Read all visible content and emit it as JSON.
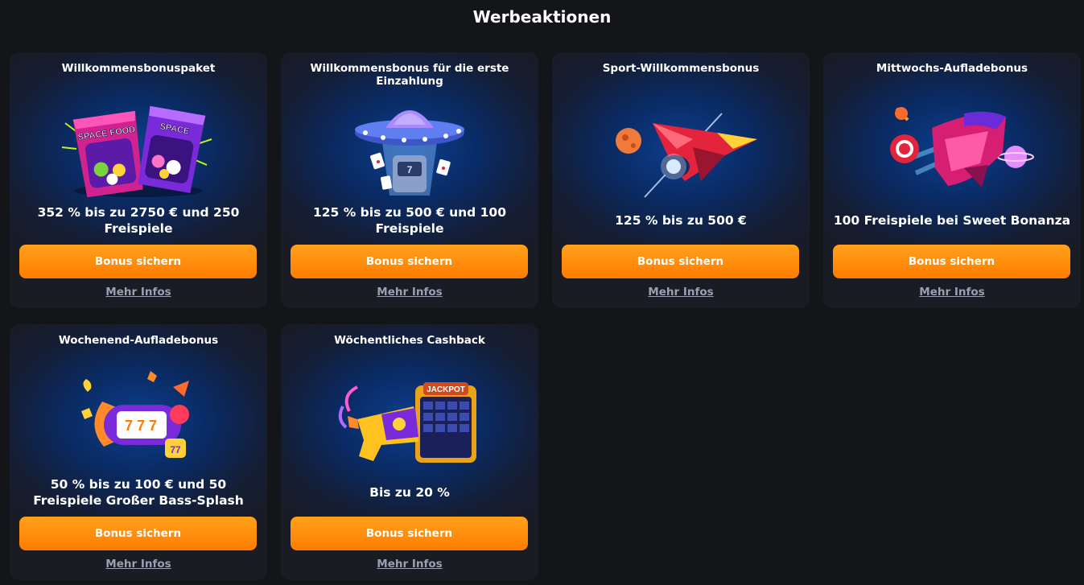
{
  "page": {
    "title": "Werbeaktionen"
  },
  "colors": {
    "background": "#141518",
    "accent": "#ff8a0a",
    "link": "#9aa0b4"
  },
  "promotions": [
    {
      "title": "Willkommensbonuspaket",
      "offer": "352 % bis zu 2750 € und 250 Freispiele",
      "button_label": "Bonus sichern",
      "link_label": "Mehr Infos",
      "image": "space-food-snack-bags",
      "image_text": "SPACE FOOD"
    },
    {
      "title": "Willkommensbonus für die erste Einzahlung",
      "offer": "125 % bis zu 500 € und 100 Freispiele",
      "button_label": "Bonus sichern",
      "link_label": "Mehr Infos",
      "image": "ufo-abducting-slot-machine"
    },
    {
      "title": "Sport-Willkommensbonus",
      "offer": "125 % bis zu 500 €",
      "button_label": "Bonus sichern",
      "link_label": "Mehr Infos",
      "image": "red-rocket-jet-with-planet"
    },
    {
      "title": "Mittwochs-Aufladebonus",
      "offer": "100 Freispiele bei Sweet Bonanza",
      "button_label": "Bonus sichern",
      "link_label": "Mehr Infos",
      "image": "pink-spaceship-with-casino-chip"
    },
    {
      "title": "Wochenend-Aufladebonus",
      "offer": "50 % bis zu 100 € und 50 Freispiele Großer Bass-Splash",
      "button_label": "Bonus sichern",
      "link_label": "Mehr Infos",
      "image": "slot-reel-rocket-777"
    },
    {
      "title": "Wöchentliches Cashback",
      "offer": "Bis zu 20 %",
      "button_label": "Bonus sichern",
      "link_label": "Mehr Infos",
      "image": "jackpot-blaster-gun",
      "image_text": "JACKPOT"
    }
  ]
}
